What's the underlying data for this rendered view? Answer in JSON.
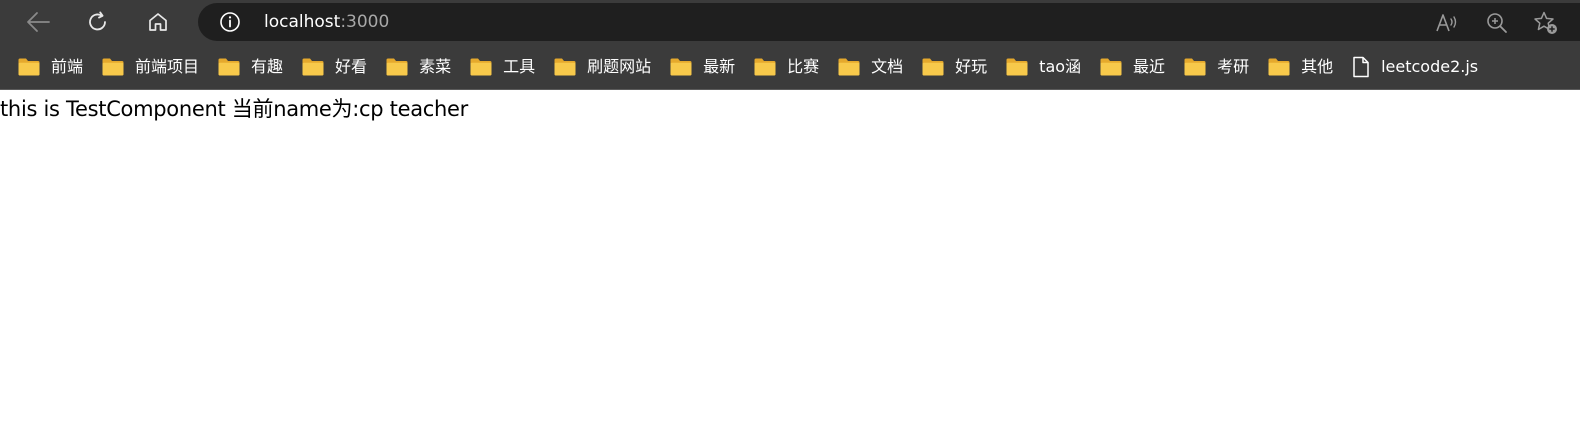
{
  "browser": {
    "url_host": "localhost",
    "url_port": ":3000",
    "icons": [
      "back-icon",
      "reload-icon",
      "home-icon",
      "info-icon",
      "read-aloud-icon",
      "zoom-icon",
      "add-favorite-icon"
    ]
  },
  "bookmarks": [
    {
      "label": "前端",
      "type": "folder"
    },
    {
      "label": "前端项目",
      "type": "folder"
    },
    {
      "label": "有趣",
      "type": "folder"
    },
    {
      "label": "好看",
      "type": "folder"
    },
    {
      "label": "素菜",
      "type": "folder"
    },
    {
      "label": "工具",
      "type": "folder"
    },
    {
      "label": "刷题网站",
      "type": "folder"
    },
    {
      "label": "最新",
      "type": "folder"
    },
    {
      "label": "比赛",
      "type": "folder"
    },
    {
      "label": "文档",
      "type": "folder"
    },
    {
      "label": "好玩",
      "type": "folder"
    },
    {
      "label": "tao涵",
      "type": "folder"
    },
    {
      "label": "最近",
      "type": "folder"
    },
    {
      "label": "考研",
      "type": "folder"
    },
    {
      "label": "其他",
      "type": "folder"
    },
    {
      "label": "leetcode2.js",
      "type": "file"
    }
  ],
  "page": {
    "text": "this is TestComponent 当前name为:cp teacher"
  },
  "colors": {
    "chrome": "#3b3b3b",
    "address_bar": "#1f1f1f",
    "folder_fill": "#f7c94b",
    "folder_tab": "#e5a92d"
  }
}
